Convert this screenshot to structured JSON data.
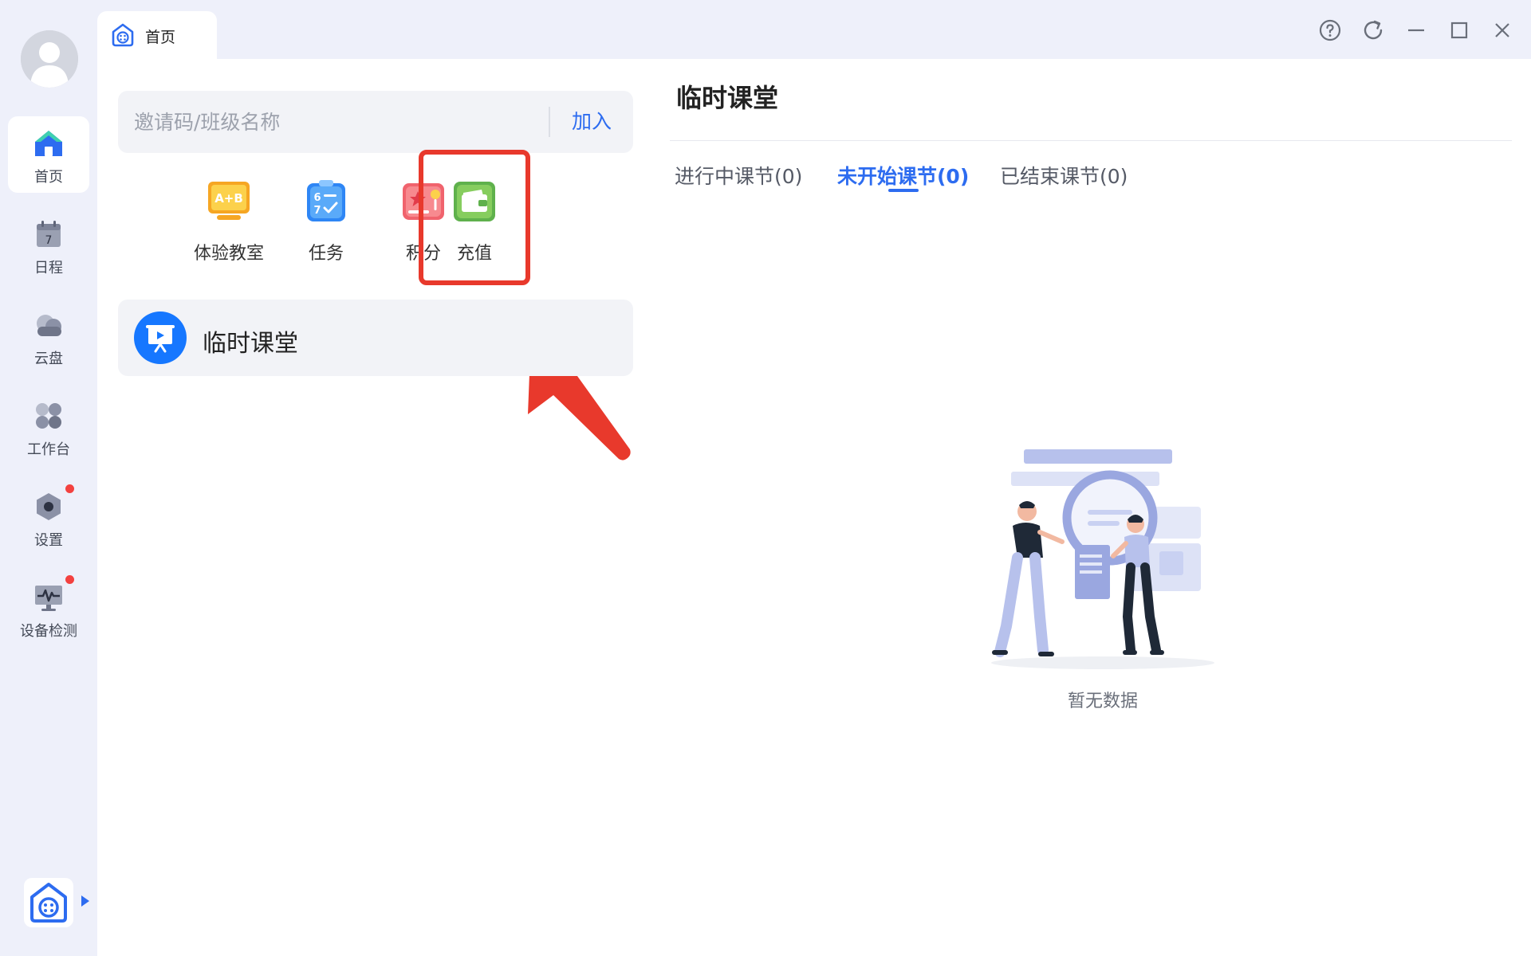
{
  "colors": {
    "accent": "#2d6cf0",
    "highlight_red": "#e8392c",
    "notification_dot": "#f3413f",
    "sidebar_bg": "#eef0fa"
  },
  "topbar": {
    "tab": {
      "label": "首页",
      "icon": "home-robot-icon"
    },
    "window_controls": [
      "help-icon",
      "refresh-icon",
      "minimize-icon",
      "maximize-icon",
      "close-icon"
    ]
  },
  "sidebar": {
    "items": [
      {
        "label": "首页",
        "icon": "home-icon",
        "active": true
      },
      {
        "label": "日程",
        "icon": "calendar-icon",
        "calendar_day": "7"
      },
      {
        "label": "云盘",
        "icon": "cloud-disk-icon"
      },
      {
        "label": "工作台",
        "icon": "workbench-icon"
      },
      {
        "label": "设置",
        "icon": "settings-icon",
        "badge": true
      },
      {
        "label": "设备检测",
        "icon": "device-check-icon",
        "badge": true
      }
    ]
  },
  "join": {
    "placeholder": "邀请码/班级名称",
    "button_label": "加入"
  },
  "quick_actions": [
    {
      "label": "体验教室",
      "icon": "experience-classroom-icon",
      "icon_text": "A+B"
    },
    {
      "label": "任务",
      "icon": "task-icon"
    },
    {
      "label": "积分",
      "icon": "points-icon"
    },
    {
      "label": "充值",
      "icon": "wallet-icon",
      "highlighted": true
    }
  ],
  "class_card": {
    "title": "临时课堂",
    "icon": "presentation-icon"
  },
  "right_panel": {
    "title": "临时课堂",
    "tabs": [
      {
        "label": "进行中课节(0)",
        "active": false
      },
      {
        "label": "未开始课节(0)",
        "active": true
      },
      {
        "label": "已结束课节(0)",
        "active": false
      }
    ],
    "empty_text": "暂无数据"
  }
}
